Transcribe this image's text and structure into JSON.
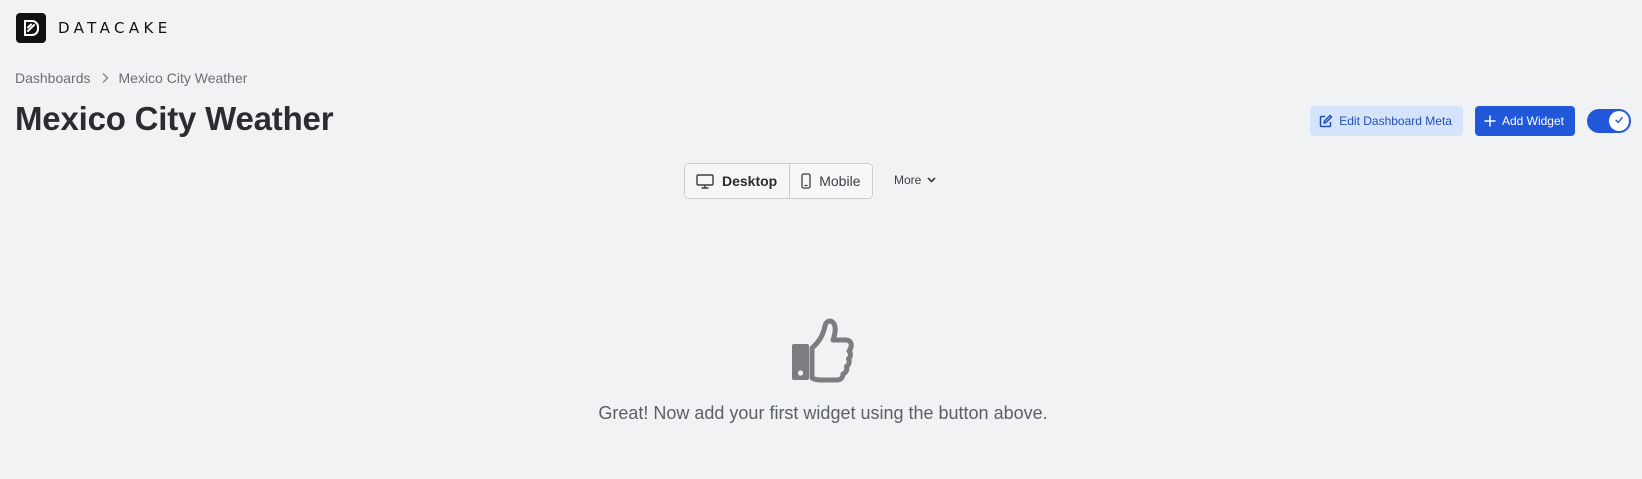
{
  "app": {
    "logo_text": "DATACAKE",
    "logo_icon": "datacake-logo-icon"
  },
  "breadcrumb": {
    "items": [
      "Dashboards",
      "Mexico City Weather"
    ],
    "separator_icon": "chevron-right-icon"
  },
  "page": {
    "title": "Mexico City Weather"
  },
  "actions": {
    "edit_meta_label": "Edit Dashboard Meta",
    "edit_meta_icon": "pencil-square-icon",
    "add_widget_label": "Add Widget",
    "add_widget_icon": "plus-icon",
    "edit_mode_toggle_on": true,
    "toggle_icon": "check-icon"
  },
  "view_switch": {
    "options": [
      {
        "label": "Desktop",
        "icon": "desktop-monitor-icon",
        "selected": true
      },
      {
        "label": "Mobile",
        "icon": "mobile-phone-icon",
        "selected": false
      }
    ],
    "more_label": "More",
    "more_icon": "chevron-down-icon"
  },
  "empty_state": {
    "icon": "thumbs-up-icon",
    "message": "Great! Now add your first widget using the button above."
  },
  "colors": {
    "background": "#f1f2f4",
    "primary": "#2158d9",
    "primary_light": "#d6e4fb",
    "text_muted": "#5b5f66"
  }
}
